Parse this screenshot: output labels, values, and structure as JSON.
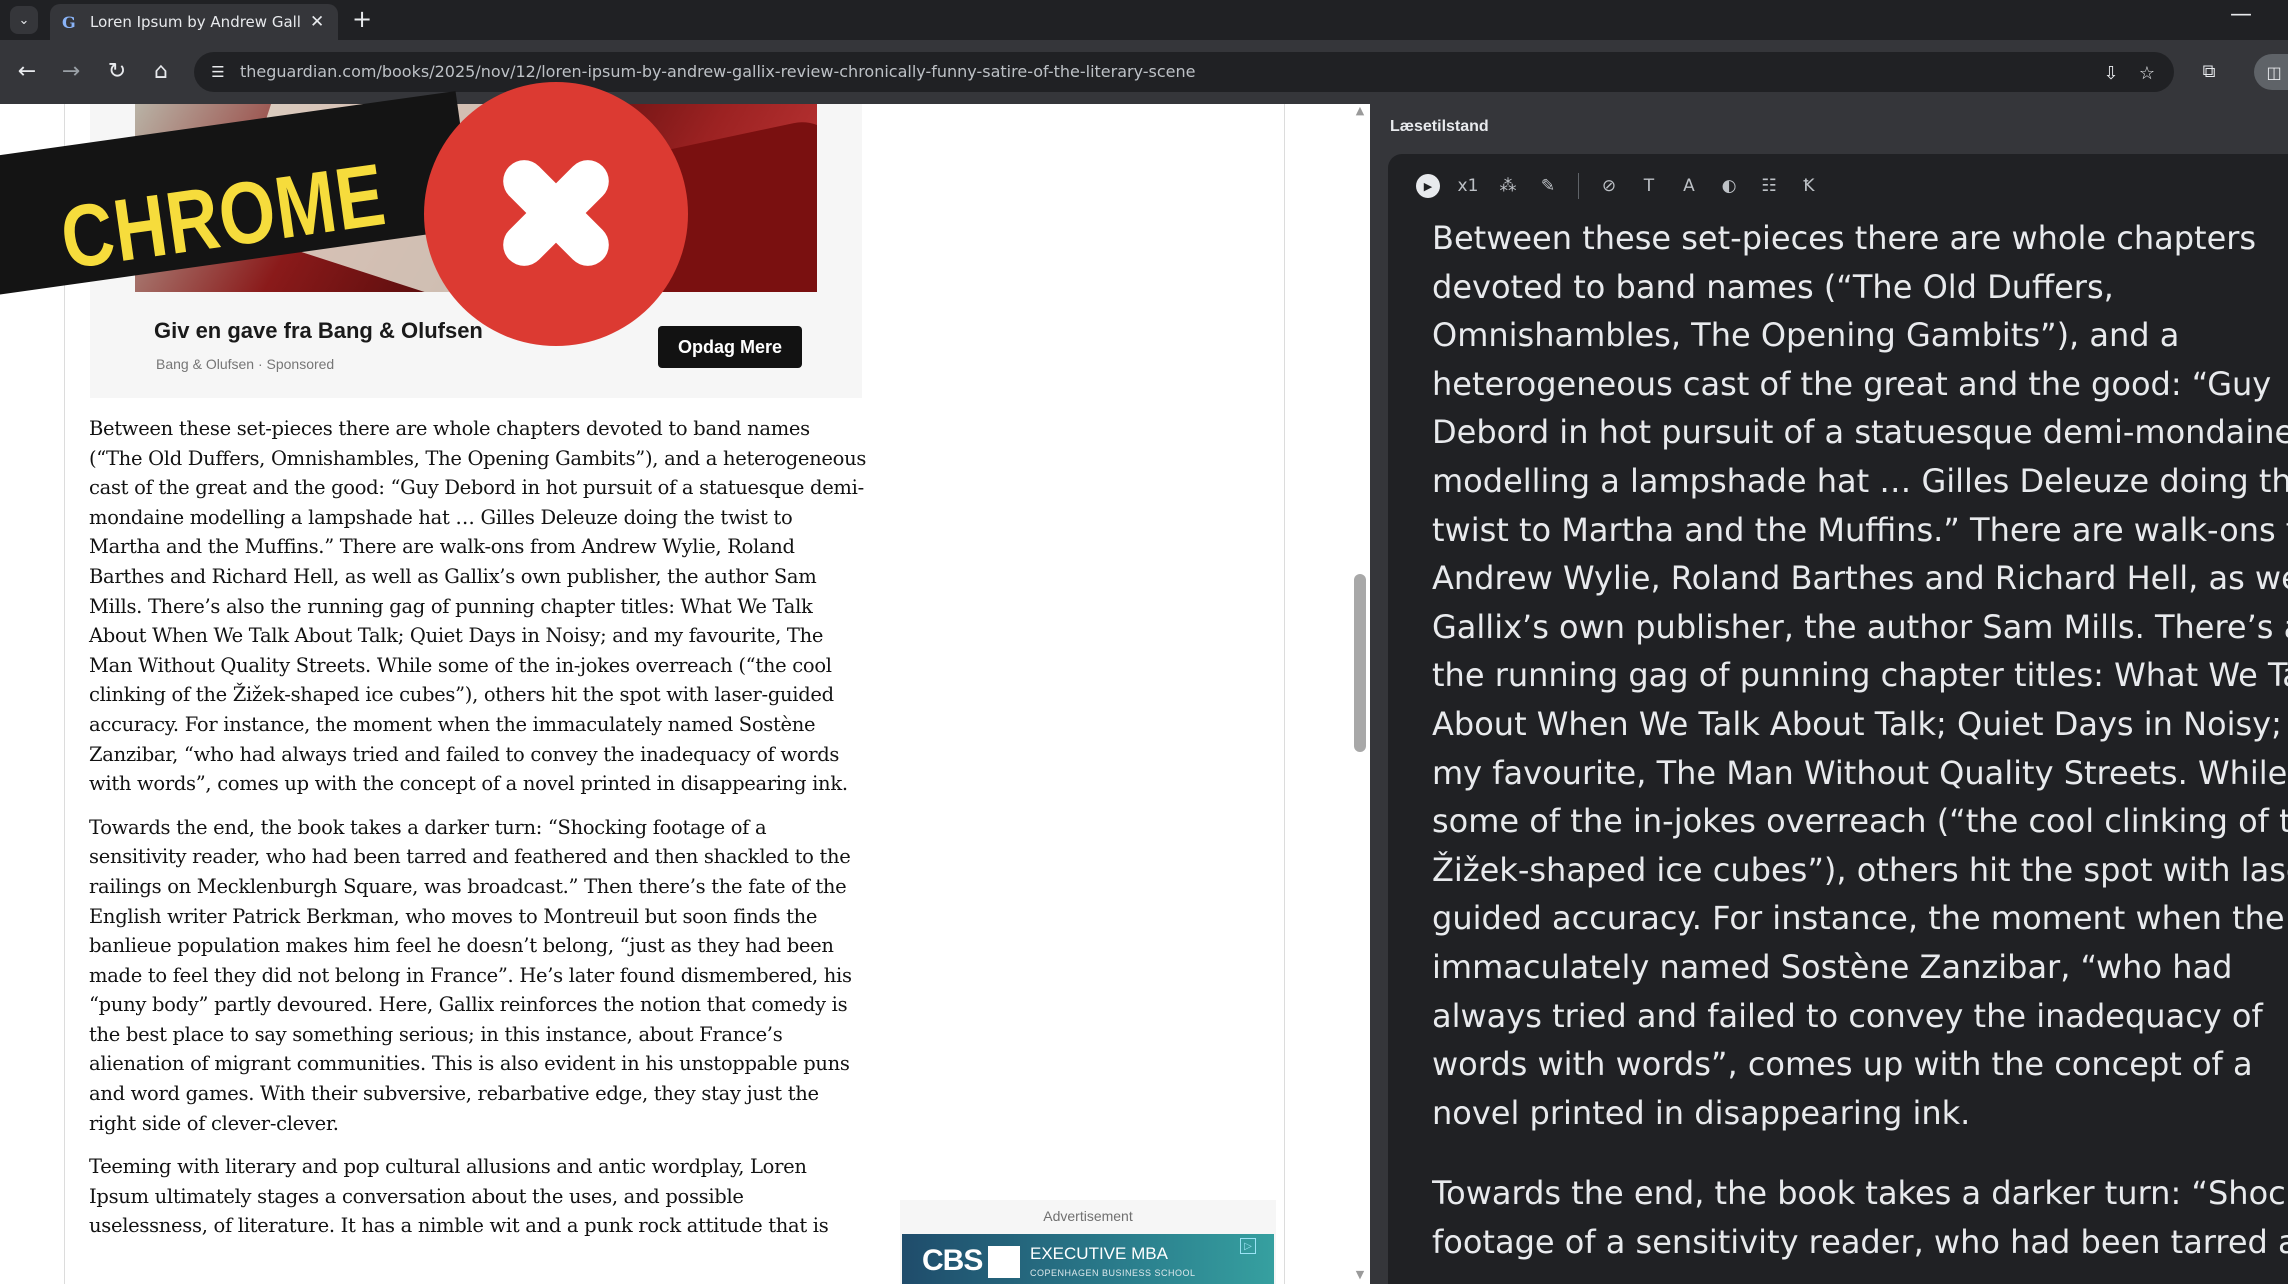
{
  "browser": {
    "tab_title": "Loren Ipsum by Andrew Gallix r",
    "favicon_letter": "G",
    "tab_close": "✕",
    "new_tab": "+",
    "minimize": "—",
    "url": "theguardian.com/books/2025/nov/12/loren-ipsum-by-andrew-gallix-review-chronically-funny-satire-of-the-literary-scene",
    "icons": {
      "tab_search": "⌄",
      "back": "←",
      "forward": "→",
      "reload": "↻",
      "home": "⌂",
      "site_info": "☰",
      "install": "⇩",
      "bookmark": "☆",
      "extensions": "⧉",
      "side_panel": "◫"
    }
  },
  "ad_card": {
    "headline": "Giv en gave fra Bang & Olufsen",
    "sponsor": "Bang & Olufsen · Sponsored",
    "cta": "Opdag Mere"
  },
  "article": {
    "paragraphs": [
      "Between these set-pieces there are whole chapters devoted to band names (“The Old Duffers, Omnishambles, The Opening Gambits”), and a heterogeneous cast of the great and the good: “Guy Debord in hot pursuit of a statuesque demi-mondaine modelling a lampshade hat … Gilles Deleuze doing the twist to Martha and the Muffins.” There are walk-ons from Andrew Wylie, Roland Barthes and Richard Hell, as well as Gallix’s own publisher, the author Sam Mills. There’s also the running gag of punning chapter titles: What We Talk About When We Talk About Talk; Quiet Days in Noisy; and my favourite, The Man Without Quality Streets. While some of the in-jokes overreach (“the cool clinking of the Žižek-shaped ice cubes”), others hit the spot with laser-guided accuracy. For instance, the moment when the immaculately named Sostène Zanzibar, “who had always tried and failed to convey the inadequacy of words with words”, comes up with the concept of a novel printed in disappearing ink.",
      "Towards the end, the book takes a darker turn: “Shocking footage of a sensitivity reader, who had been tarred and feathered and then shackled to the railings on Mecklenburgh Square, was broadcast.” Then there’s the fate of the English writer Patrick Berkman, who moves to Montreuil but soon finds the banlieue population makes him feel he doesn’t belong, “just as they had been made to feel they did not belong in France”. He’s later found dismembered, his “puny body” partly devoured. Here, Gallix reinforces the notion that comedy is the best place to say something serious; in this instance, about France’s alienation of migrant communities. This is also evident in his unstoppable puns and word games. With their subversive, rebarbative edge, they stay just the right side of clever-clever.",
      "Teeming with literary and pop cultural allusions and antic wordplay, Loren Ipsum ultimately stages a conversation about the uses, and possible uselessness, of literature. It has a nimble wit and a punk rock attitude that is"
    ]
  },
  "advert": {
    "label": "Advertisement",
    "logo": "CBS",
    "title": "EXECUTIVE MBA",
    "subtitle": "COPENHAGEN BUSINESS SCHOOL",
    "adchoice": "▷"
  },
  "scrollbar": {
    "up": "▲",
    "down": "▼"
  },
  "reading_mode": {
    "title": "Læsetilstand",
    "tools": {
      "play": "▶",
      "speed": "x1",
      "voice": "⁂",
      "highlight": "✎",
      "link": "⊘",
      "text_size": "T",
      "font": "A",
      "theme": "◐",
      "spacing": "☷",
      "line_spacing": "Ꝁ"
    },
    "paragraphs": [
      [
        "Between these set-pieces there are whole chapters",
        "devoted to band names (“The Old Duffers,",
        "Omnishambles, The Opening Gambits”), and a",
        "heterogeneous cast of the great and the good: “Guy",
        "Debord in hot pursuit of a statuesque demi-mondaine",
        "modelling a lampshade hat … Gilles Deleuze doing the",
        "twist to Martha and the Muffins.” There are walk-ons from",
        "Andrew Wylie, Roland Barthes and Richard Hell, as well as",
        "Gallix’s own publisher, the author Sam Mills. There’s also",
        "the running gag of punning chapter titles: What We Talk",
        "About When We Talk About Talk; Quiet Days in Noisy; and",
        "my favourite, The Man Without Quality Streets. While",
        "some of the in-jokes overreach (“the cool clinking of the",
        "Žižek-shaped ice cubes”), others hit the spot with laser-",
        "guided accuracy. For instance, the moment when the",
        "immaculately named Sostène Zanzibar, “who had",
        "always tried and failed to convey the inadequacy of",
        "words with words”, comes up with the concept of a",
        "novel printed in disappearing ink."
      ],
      [
        "Towards the end, the book takes a darker turn: “Shocking",
        "footage of a sensitivity reader, who had been tarred and"
      ]
    ]
  },
  "overlay": {
    "label": "CHROME"
  }
}
